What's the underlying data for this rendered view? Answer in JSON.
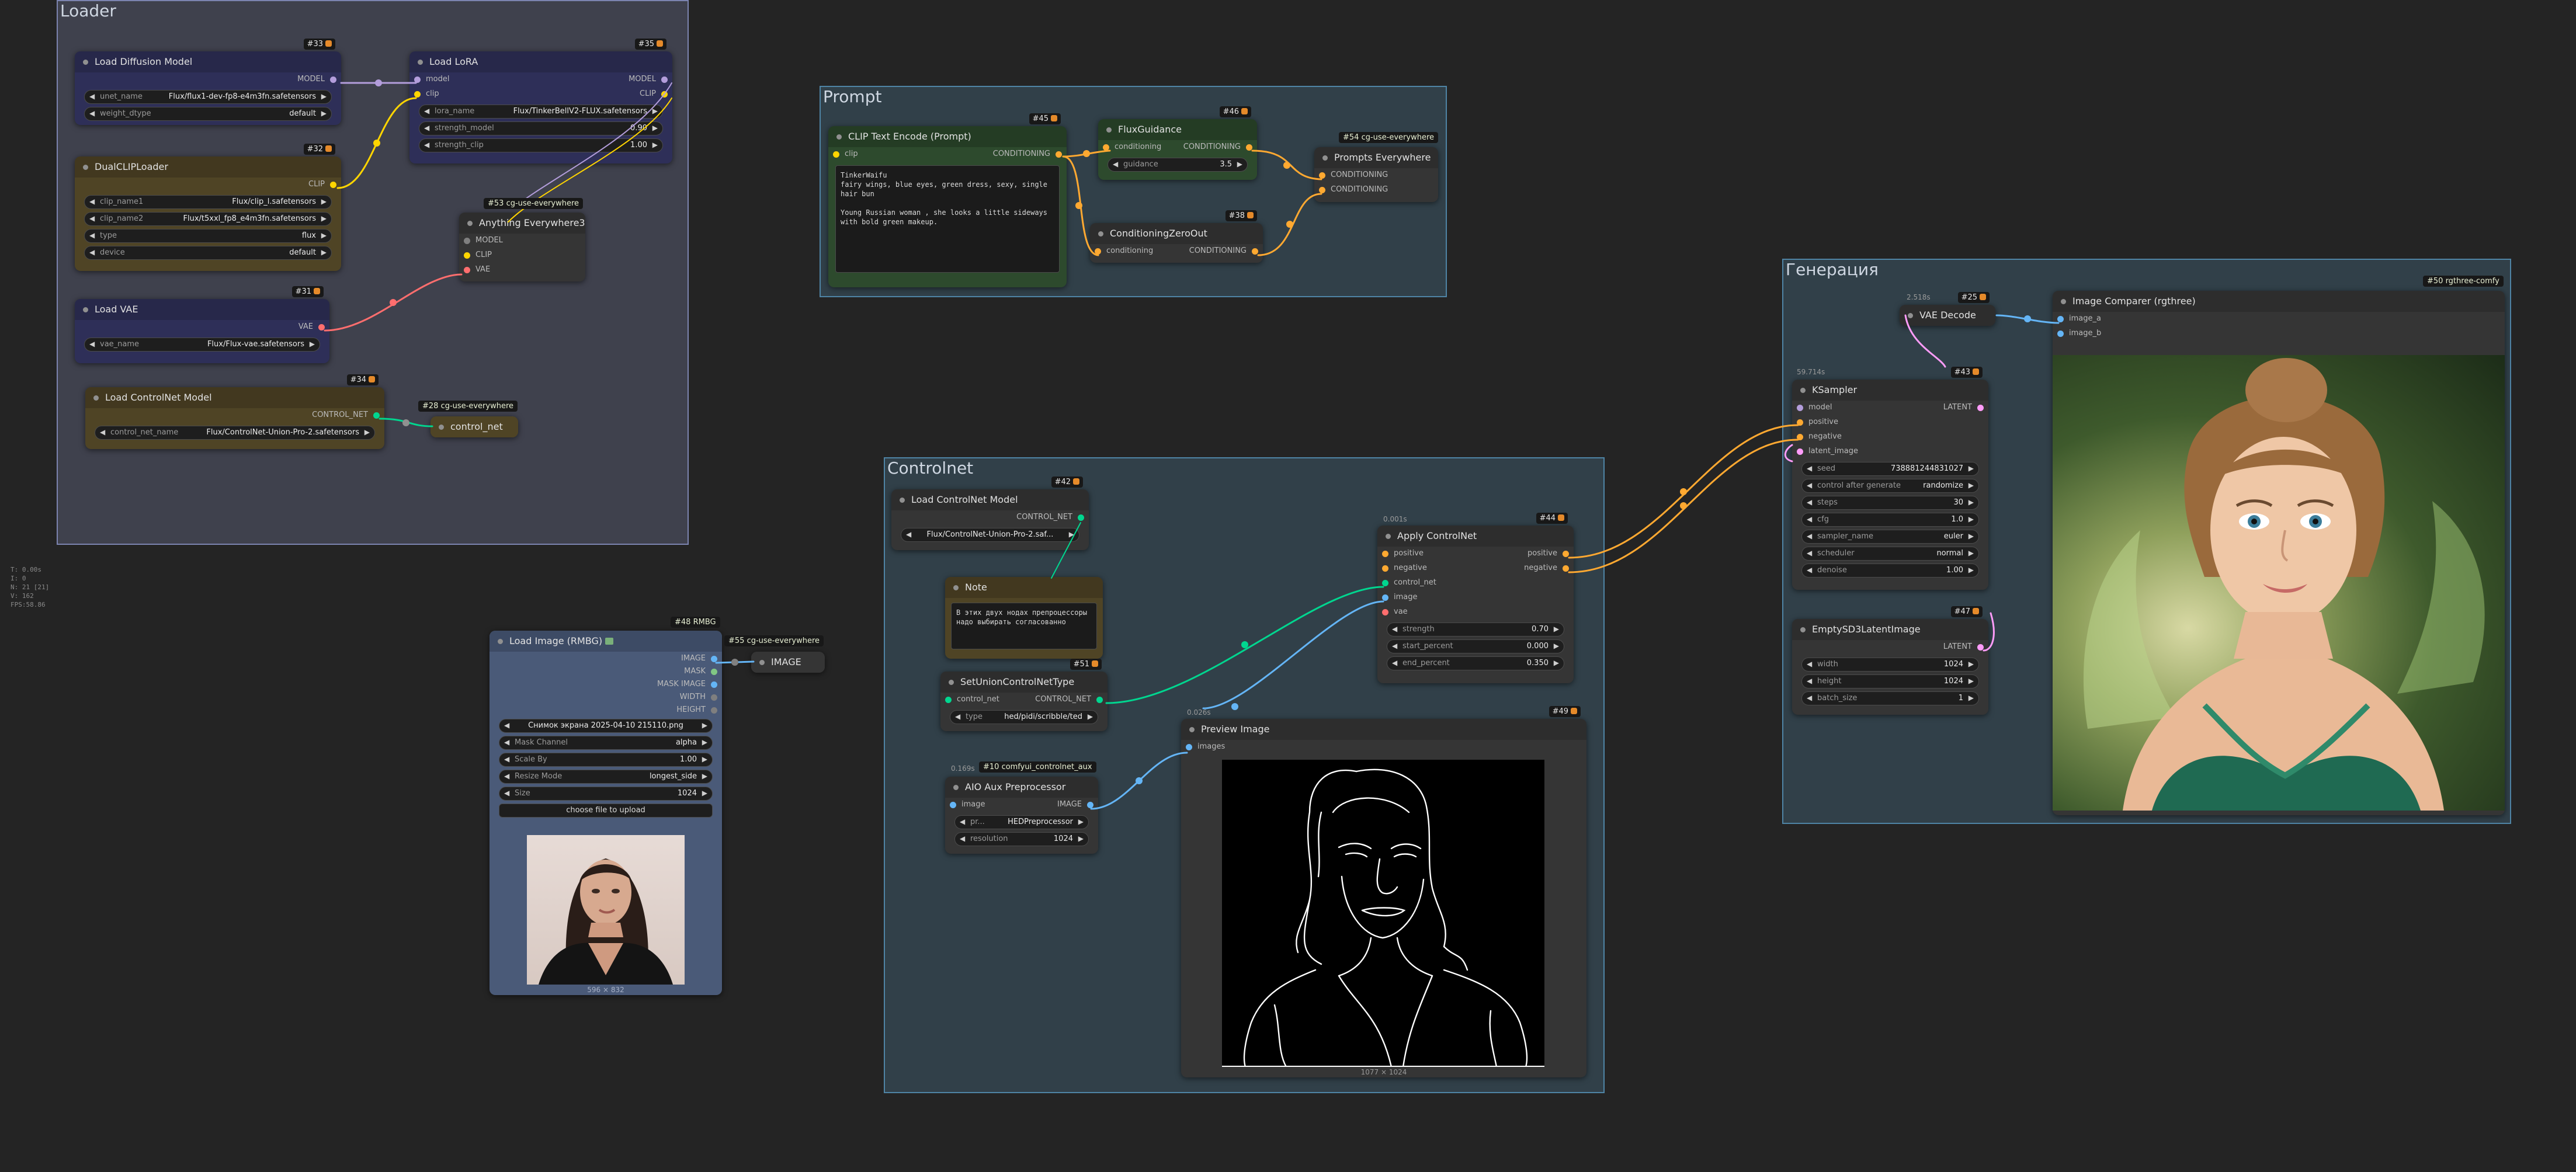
{
  "stats": [
    "T: 0.00s",
    "I: 0",
    "N: 21 [21]",
    "V: 162",
    "FPS:58.86"
  ],
  "groups": {
    "loader": "Loader",
    "prompt": "Prompt",
    "controlnet": "Controlnet",
    "generation": "Генерация"
  },
  "load_diffusion": {
    "id": "#33",
    "title": "Load Diffusion Model",
    "out": "MODEL",
    "w1_label": "unet_name",
    "w1_value": "Flux/flux1-dev-fp8-e4m3fn.safetensors",
    "w2_label": "weight_dtype",
    "w2_value": "default"
  },
  "load_lora": {
    "id": "#35",
    "title": "Load LoRA",
    "in1": "model",
    "in2": "clip",
    "out1": "MODEL",
    "out2": "CLIP",
    "w1_label": "lora_name",
    "w1_value": "Flux/TinkerBellV2-FLUX.safetensors",
    "w2_label": "strength_model",
    "w2_value": "0.90",
    "w3_label": "strength_clip",
    "w3_value": "1.00"
  },
  "dualclip": {
    "id": "#32",
    "title": "DualCLIPLoader",
    "out": "CLIP",
    "w1_label": "clip_name1",
    "w1_value": "Flux/clip_l.safetensors",
    "w2_label": "clip_name2",
    "w2_value": "Flux/t5xxl_fp8_e4m3fn.safetensors",
    "w3_label": "type",
    "w3_value": "flux",
    "w4_label": "device",
    "w4_value": "default"
  },
  "anything": {
    "badge": "#53 cg-use-everywhere",
    "title": "Anything Everywhere3",
    "in1": "MODEL",
    "in2": "CLIP",
    "in3": "VAE"
  },
  "load_vae": {
    "id": "#31",
    "title": "Load VAE",
    "out": "VAE",
    "w1_label": "vae_name",
    "w1_value": "Flux/Flux-vae.safetensors"
  },
  "load_cn_1": {
    "id": "#34",
    "title": "Load ControlNet Model",
    "out": "CONTROL_NET",
    "w1_label": "control_net_name",
    "w1_value": "Flux/ControlNet-Union-Pro-2.safetensors"
  },
  "cn_everywhere": {
    "badge": "#28 cg-use-everywhere",
    "title": "control_net"
  },
  "clip_encode": {
    "id": "#45",
    "title": "CLIP Text Encode (Prompt)",
    "in1": "clip",
    "out1": "CONDITIONING",
    "text": "TinkerWaifu\nfairy wings, blue eyes, green dress, sexy, single hair bun\n\nYoung Russian woman , she looks a little sideways with bold green makeup."
  },
  "flux_guidance": {
    "id": "#46",
    "title": "FluxGuidance",
    "in1": "conditioning",
    "out1": "CONDITIONING",
    "w1_label": "guidance",
    "w1_value": "3.5"
  },
  "cond_zero": {
    "id": "#38",
    "title": "ConditioningZeroOut",
    "in1": "conditioning",
    "out1": "CONDITIONING"
  },
  "prompts_everywhere": {
    "badge": "#54 cg-use-everywhere",
    "title": "Prompts Everywhere",
    "in1": "CONDITIONING",
    "in2": "CONDITIONING"
  },
  "load_cn_2": {
    "id": "#42",
    "title": "Load ControlNet Model",
    "out": "CONTROL_NET",
    "w1_value": "Flux/ControlNet-Union-Pro-2.saf..."
  },
  "note": {
    "title": "Note",
    "text": "В этих двух нодах препроцессоры\nнадо выбирать согласованно"
  },
  "set_union": {
    "id": "#51",
    "title": "SetUnionControlNetType",
    "in1": "control_net",
    "out1": "CONTROL_NET",
    "w1_label": "type",
    "w1_value": "hed/pidi/scribble/ted"
  },
  "aio": {
    "badge": "#10 comfyui_controlnet_aux",
    "timing": "0.169s",
    "title": "AIO Aux Preprocessor",
    "in1": "image",
    "out1": "IMAGE",
    "w1_label": "pr...",
    "w1_value": "HEDPreprocessor",
    "w2_label": "resolution",
    "w2_value": "1024"
  },
  "apply_cn": {
    "id": "#44",
    "timing": "0.001s",
    "title": "Apply ControlNet",
    "in1": "positive",
    "in2": "negative",
    "in3": "control_net",
    "in4": "image",
    "in5": "vae",
    "out1": "positive",
    "out2": "negative",
    "w1_label": "strength",
    "w1_value": "0.70",
    "w2_label": "start_percent",
    "w2_value": "0.000",
    "w3_label": "end_percent",
    "w3_value": "0.350"
  },
  "preview": {
    "id": "#49",
    "timing": "0.026s",
    "title": "Preview Image",
    "in1": "images",
    "caption": "1077 × 1024"
  },
  "load_image": {
    "badge": "#48 RMBG",
    "title": "Load Image (RMBG)",
    "out1": "IMAGE",
    "out2": "MASK",
    "out3": "MASK IMAGE",
    "out4": "WIDTH",
    "out5": "HEIGHT",
    "w1_value": "Снимок экрана 2025-04-10 215110.png",
    "w2_label": "Mask Channel",
    "w2_value": "alpha",
    "w3_label": "Scale By",
    "w3_value": "1.00",
    "w4_label": "Resize Mode",
    "w4_value": "longest_side",
    "w5_label": "Size",
    "w5_value": "1024",
    "upload": "choose file to upload",
    "caption": "596 × 832"
  },
  "image_everywhere": {
    "badge": "#55 cg-use-everywhere",
    "title": "IMAGE"
  },
  "vae_decode": {
    "id": "#25",
    "timing": "2.518s",
    "title": "VAE Decode"
  },
  "comparer": {
    "badge": "#50 rgthree-comfy",
    "title": "Image Comparer (rgthree)",
    "in1": "image_a",
    "in2": "image_b"
  },
  "ksampler": {
    "id": "#43",
    "timing": "59.714s",
    "title": "KSampler",
    "in1": "model",
    "in2": "positive",
    "in3": "negative",
    "in4": "latent_image",
    "out1": "LATENT",
    "w1_label": "seed",
    "w1_value": "738881244831027",
    "w2_label": "control after generate",
    "w2_value": "randomize",
    "w3_label": "steps",
    "w3_value": "30",
    "w4_label": "cfg",
    "w4_value": "1.0",
    "w5_label": "sampler_name",
    "w5_value": "euler",
    "w6_label": "scheduler",
    "w6_value": "normal",
    "w7_label": "denoise",
    "w7_value": "1.00"
  },
  "empty_latent": {
    "id": "#47",
    "title": "EmptySD3LatentImage",
    "out1": "LATENT",
    "w1_label": "width",
    "w1_value": "1024",
    "w2_label": "height",
    "w2_value": "1024",
    "w3_label": "batch_size",
    "w3_value": "1"
  },
  "colors": {
    "model": "#b39ddb",
    "clip": "#ffd500",
    "vae": "#ff6e6e",
    "control_net": "#00d68f",
    "conditioning": "#ffa931",
    "image": "#64b5f6",
    "latent": "#ff9cf9"
  }
}
